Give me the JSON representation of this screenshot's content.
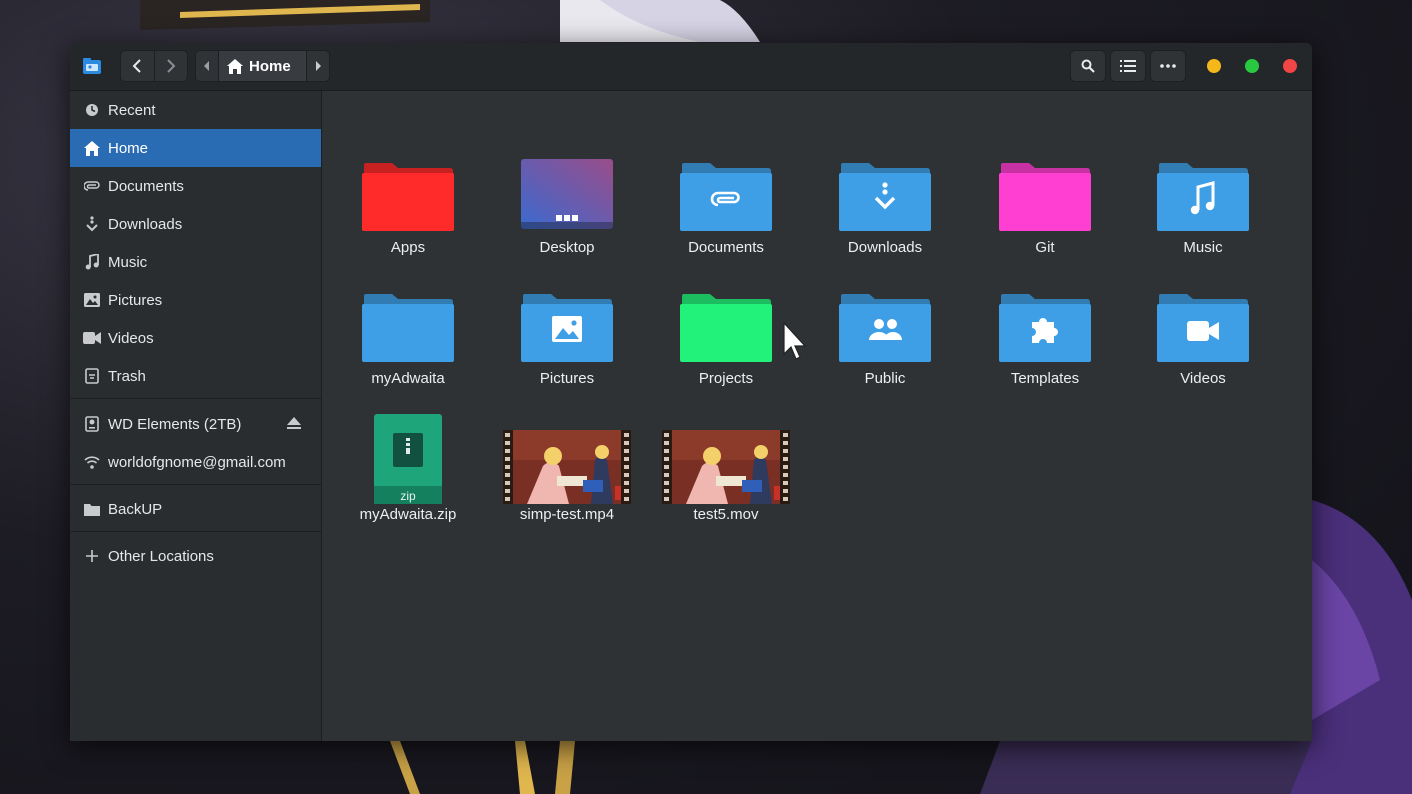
{
  "window": {
    "title": "Home"
  },
  "header": {
    "path_label": "Home",
    "icons": [
      "files-app-icon",
      "back-icon",
      "forward-icon",
      "path-left-icon",
      "home-icon",
      "path-right-icon",
      "search-icon",
      "list-view-icon",
      "menu-icon"
    ]
  },
  "window_controls": {
    "minimize_color": "#f5b81a",
    "maximize_color": "#28c840",
    "close_color": "#f04646"
  },
  "sidebar": {
    "places": [
      {
        "label": "Recent",
        "icon": "clock-icon"
      },
      {
        "label": "Home",
        "icon": "home-icon",
        "active": true
      },
      {
        "label": "Documents",
        "icon": "paperclip-icon"
      },
      {
        "label": "Downloads",
        "icon": "download-icon"
      },
      {
        "label": "Music",
        "icon": "music-note-icon"
      },
      {
        "label": "Pictures",
        "icon": "image-icon"
      },
      {
        "label": "Videos",
        "icon": "video-camera-icon"
      },
      {
        "label": "Trash",
        "icon": "trash-icon"
      }
    ],
    "devices": [
      {
        "label": "WD Elements (2TB)",
        "icon": "drive-icon"
      },
      {
        "label": "worldofgnome@gmail.com",
        "icon": "wifi-icon"
      }
    ],
    "bookmarks": [
      {
        "label": "BackUP",
        "icon": "folder-icon"
      }
    ],
    "other": {
      "label": "Other Locations",
      "icon": "plus-icon"
    }
  },
  "files": [
    {
      "name": "Apps",
      "kind": "folder",
      "color": "#ff2a2a",
      "icon": "none"
    },
    {
      "name": "Desktop",
      "kind": "desktop"
    },
    {
      "name": "Documents",
      "kind": "folder",
      "color": "#3f9fe6",
      "icon": "paperclip-icon"
    },
    {
      "name": "Downloads",
      "kind": "folder",
      "color": "#3f9fe6",
      "icon": "download-icon"
    },
    {
      "name": "Git",
      "kind": "folder",
      "color": "#ff3fd2",
      "icon": "none"
    },
    {
      "name": "Music",
      "kind": "folder",
      "color": "#3f9fe6",
      "icon": "music-note-icon"
    },
    {
      "name": "myAdwaita",
      "kind": "folder",
      "color": "#3f9fe6",
      "icon": "none"
    },
    {
      "name": "Pictures",
      "kind": "folder",
      "color": "#3f9fe6",
      "icon": "image-icon"
    },
    {
      "name": "Projects",
      "kind": "folder",
      "color": "#22f27a",
      "icon": "none"
    },
    {
      "name": "Public",
      "kind": "folder",
      "color": "#3f9fe6",
      "icon": "people-icon"
    },
    {
      "name": "Templates",
      "kind": "folder",
      "color": "#3f9fe6",
      "icon": "puzzle-icon"
    },
    {
      "name": "Videos",
      "kind": "folder",
      "color": "#3f9fe6",
      "icon": "video-camera-icon"
    },
    {
      "name": "myAdwaita.zip",
      "kind": "zip",
      "badge": "zip"
    },
    {
      "name": "simp-test.mp4",
      "kind": "video"
    },
    {
      "name": "test5.mov",
      "kind": "video"
    }
  ]
}
